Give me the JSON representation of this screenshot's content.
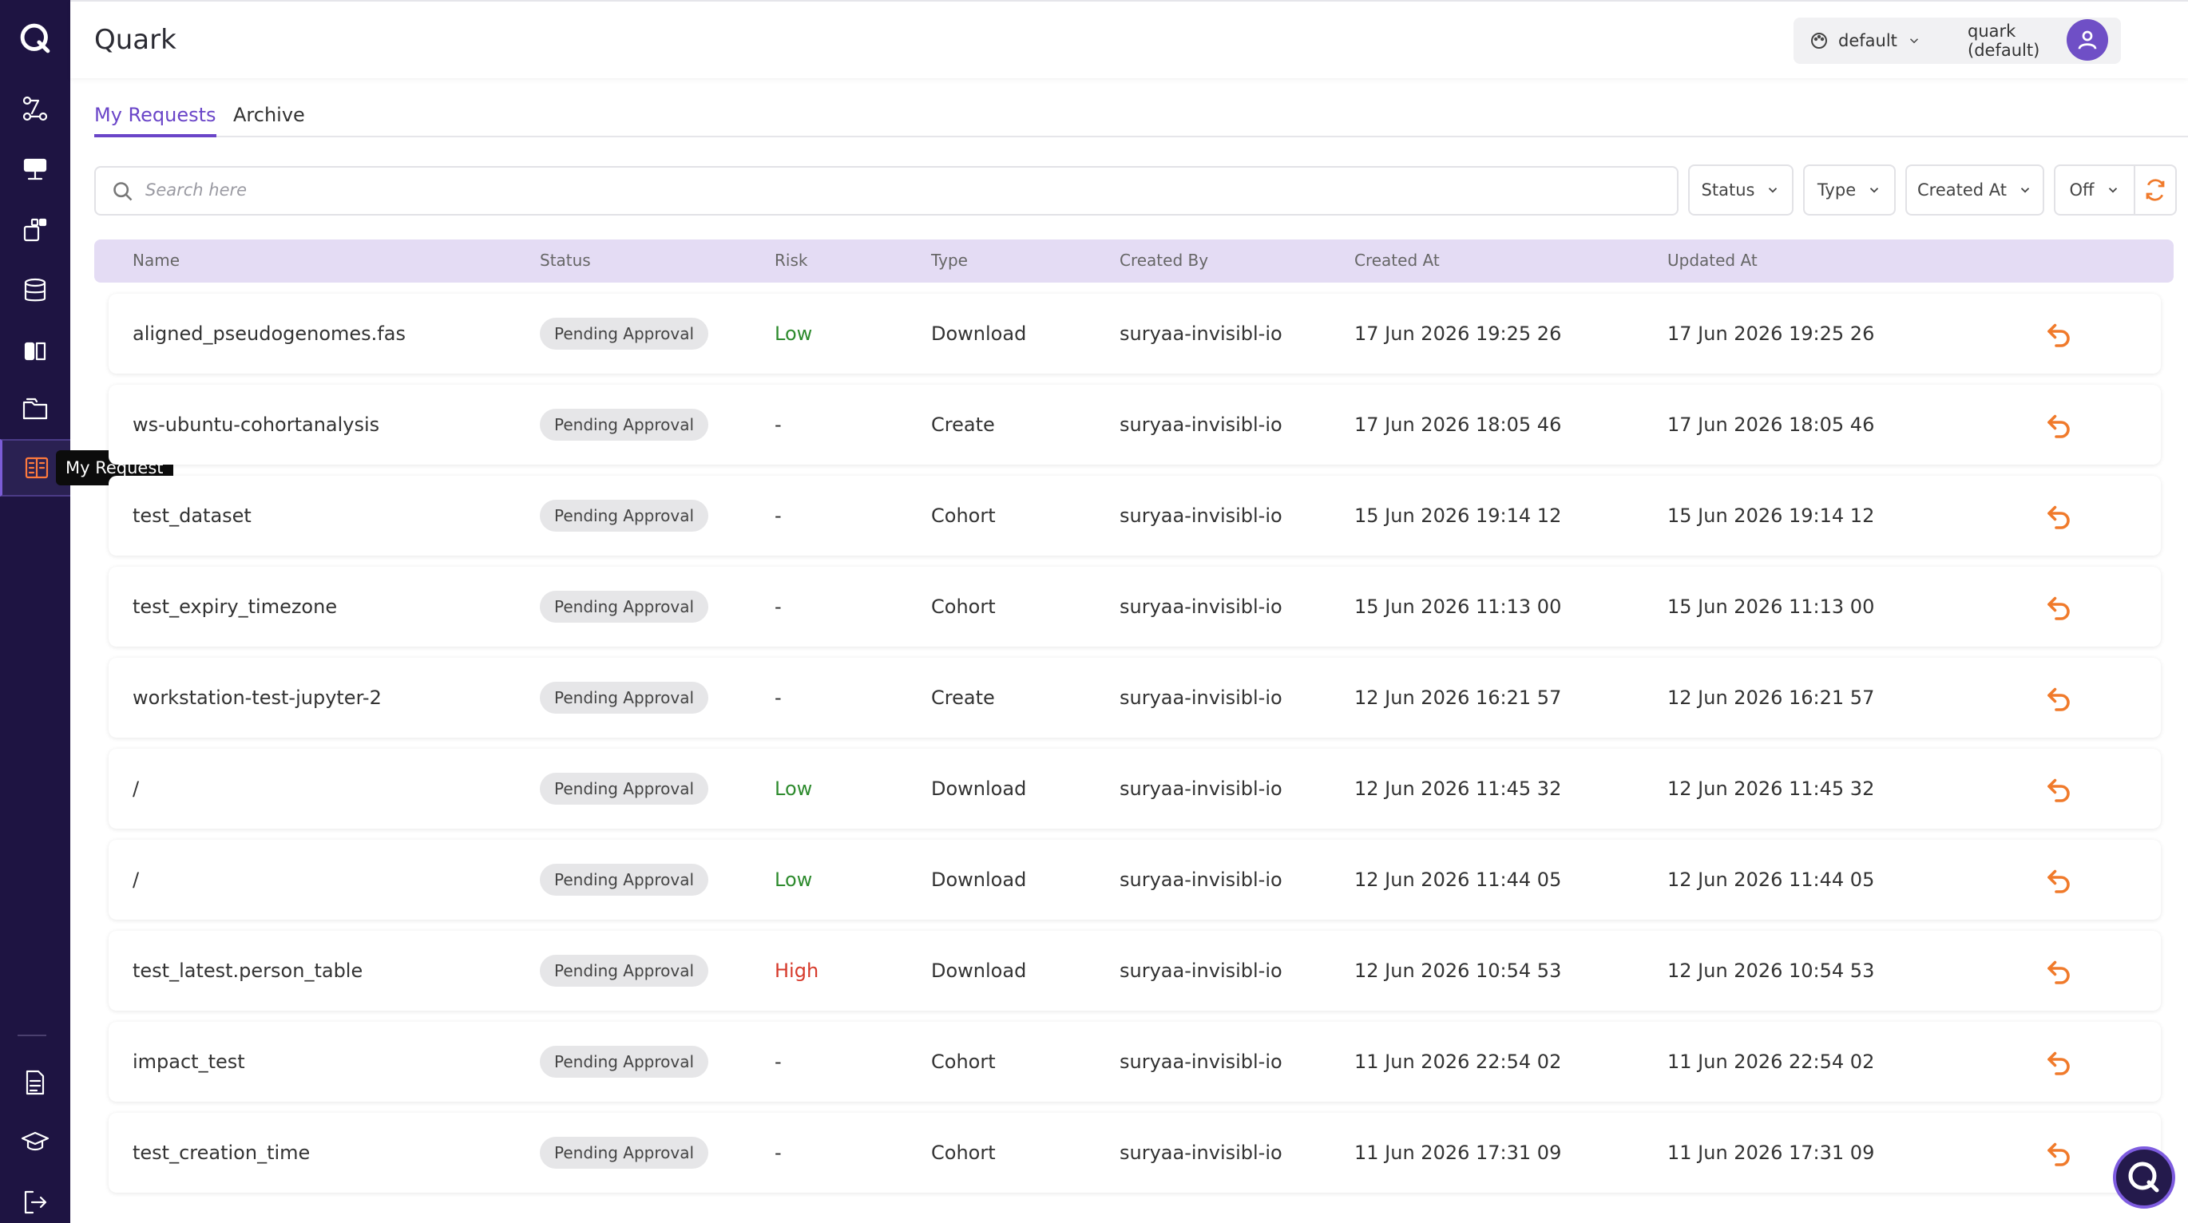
{
  "app": {
    "title": "Quark"
  },
  "header": {
    "theme_label": "default",
    "workspace_label": "quark (default)"
  },
  "sidebar": {
    "tooltip": "My Request",
    "items": [
      {
        "icon": "logo-q-icon"
      },
      {
        "icon": "workflow-icon"
      },
      {
        "icon": "workstation-icon"
      },
      {
        "icon": "apps-icon"
      },
      {
        "icon": "database-icon"
      },
      {
        "icon": "cohort-icon"
      },
      {
        "icon": "folder-icon"
      },
      {
        "icon": "my-request-icon",
        "active": true
      },
      {
        "icon": "document-icon"
      },
      {
        "icon": "graduation-cap-icon"
      },
      {
        "icon": "logout-icon"
      }
    ]
  },
  "tabs": [
    {
      "label": "My Requests",
      "active": true
    },
    {
      "label": "Archive"
    }
  ],
  "search": {
    "placeholder": "Search here"
  },
  "filters": {
    "status": "Status",
    "type": "Type",
    "created_at": "Created At",
    "toggle": "Off"
  },
  "table": {
    "columns": [
      "Name",
      "Status",
      "Risk",
      "Type",
      "Created By",
      "Created At",
      "Updated At"
    ],
    "rows": [
      {
        "name": "aligned_pseudogenomes.fas",
        "status": "Pending Approval",
        "risk": "Low",
        "type": "Download",
        "created_by": "suryaa-invisibl-io",
        "created_at": "17 Jun 2026 19:25 26",
        "updated_at": "17 Jun 2026 19:25 26"
      },
      {
        "name": "ws-ubuntu-cohortanalysis",
        "status": "Pending Approval",
        "risk": "-",
        "type": "Create",
        "created_by": "suryaa-invisibl-io",
        "created_at": "17 Jun 2026 18:05 46",
        "updated_at": "17 Jun 2026 18:05 46"
      },
      {
        "name": "test_dataset",
        "status": "Pending Approval",
        "risk": "-",
        "type": "Cohort",
        "created_by": "suryaa-invisibl-io",
        "created_at": "15 Jun 2026 19:14 12",
        "updated_at": "15 Jun 2026 19:14 12"
      },
      {
        "name": "test_expiry_timezone",
        "status": "Pending Approval",
        "risk": "-",
        "type": "Cohort",
        "created_by": "suryaa-invisibl-io",
        "created_at": "15 Jun 2026 11:13 00",
        "updated_at": "15 Jun 2026 11:13 00"
      },
      {
        "name": "workstation-test-jupyter-2",
        "status": "Pending Approval",
        "risk": "-",
        "type": "Create",
        "created_by": "suryaa-invisibl-io",
        "created_at": "12 Jun 2026 16:21 57",
        "updated_at": "12 Jun 2026 16:21 57"
      },
      {
        "name": "/",
        "status": "Pending Approval",
        "risk": "Low",
        "type": "Download",
        "created_by": "suryaa-invisibl-io",
        "created_at": "12 Jun 2026 11:45 32",
        "updated_at": "12 Jun 2026 11:45 32"
      },
      {
        "name": "/",
        "status": "Pending Approval",
        "risk": "Low",
        "type": "Download",
        "created_by": "suryaa-invisibl-io",
        "created_at": "12 Jun 2026 11:44 05",
        "updated_at": "12 Jun 2026 11:44 05"
      },
      {
        "name": "test_latest.person_table",
        "status": "Pending Approval",
        "risk": "High",
        "type": "Download",
        "created_by": "suryaa-invisibl-io",
        "created_at": "12 Jun 2026 10:54 53",
        "updated_at": "12 Jun 2026 10:54 53"
      },
      {
        "name": "impact_test",
        "status": "Pending Approval",
        "risk": "-",
        "type": "Cohort",
        "created_by": "suryaa-invisibl-io",
        "created_at": "11 Jun 2026 22:54 02",
        "updated_at": "11 Jun 2026 22:54 02"
      },
      {
        "name": "test_creation_time",
        "status": "Pending Approval",
        "risk": "-",
        "type": "Cohort",
        "created_by": "suryaa-invisibl-io",
        "created_at": "11 Jun 2026 17:31 09",
        "updated_at": "11 Jun 2026 17:31 09"
      }
    ]
  },
  "colors": {
    "sidebar": "#1e1442",
    "accent": "#6a45c8",
    "action": "#f07a2b",
    "risk_low": "#2e8b2e",
    "risk_high": "#d63a2b"
  }
}
